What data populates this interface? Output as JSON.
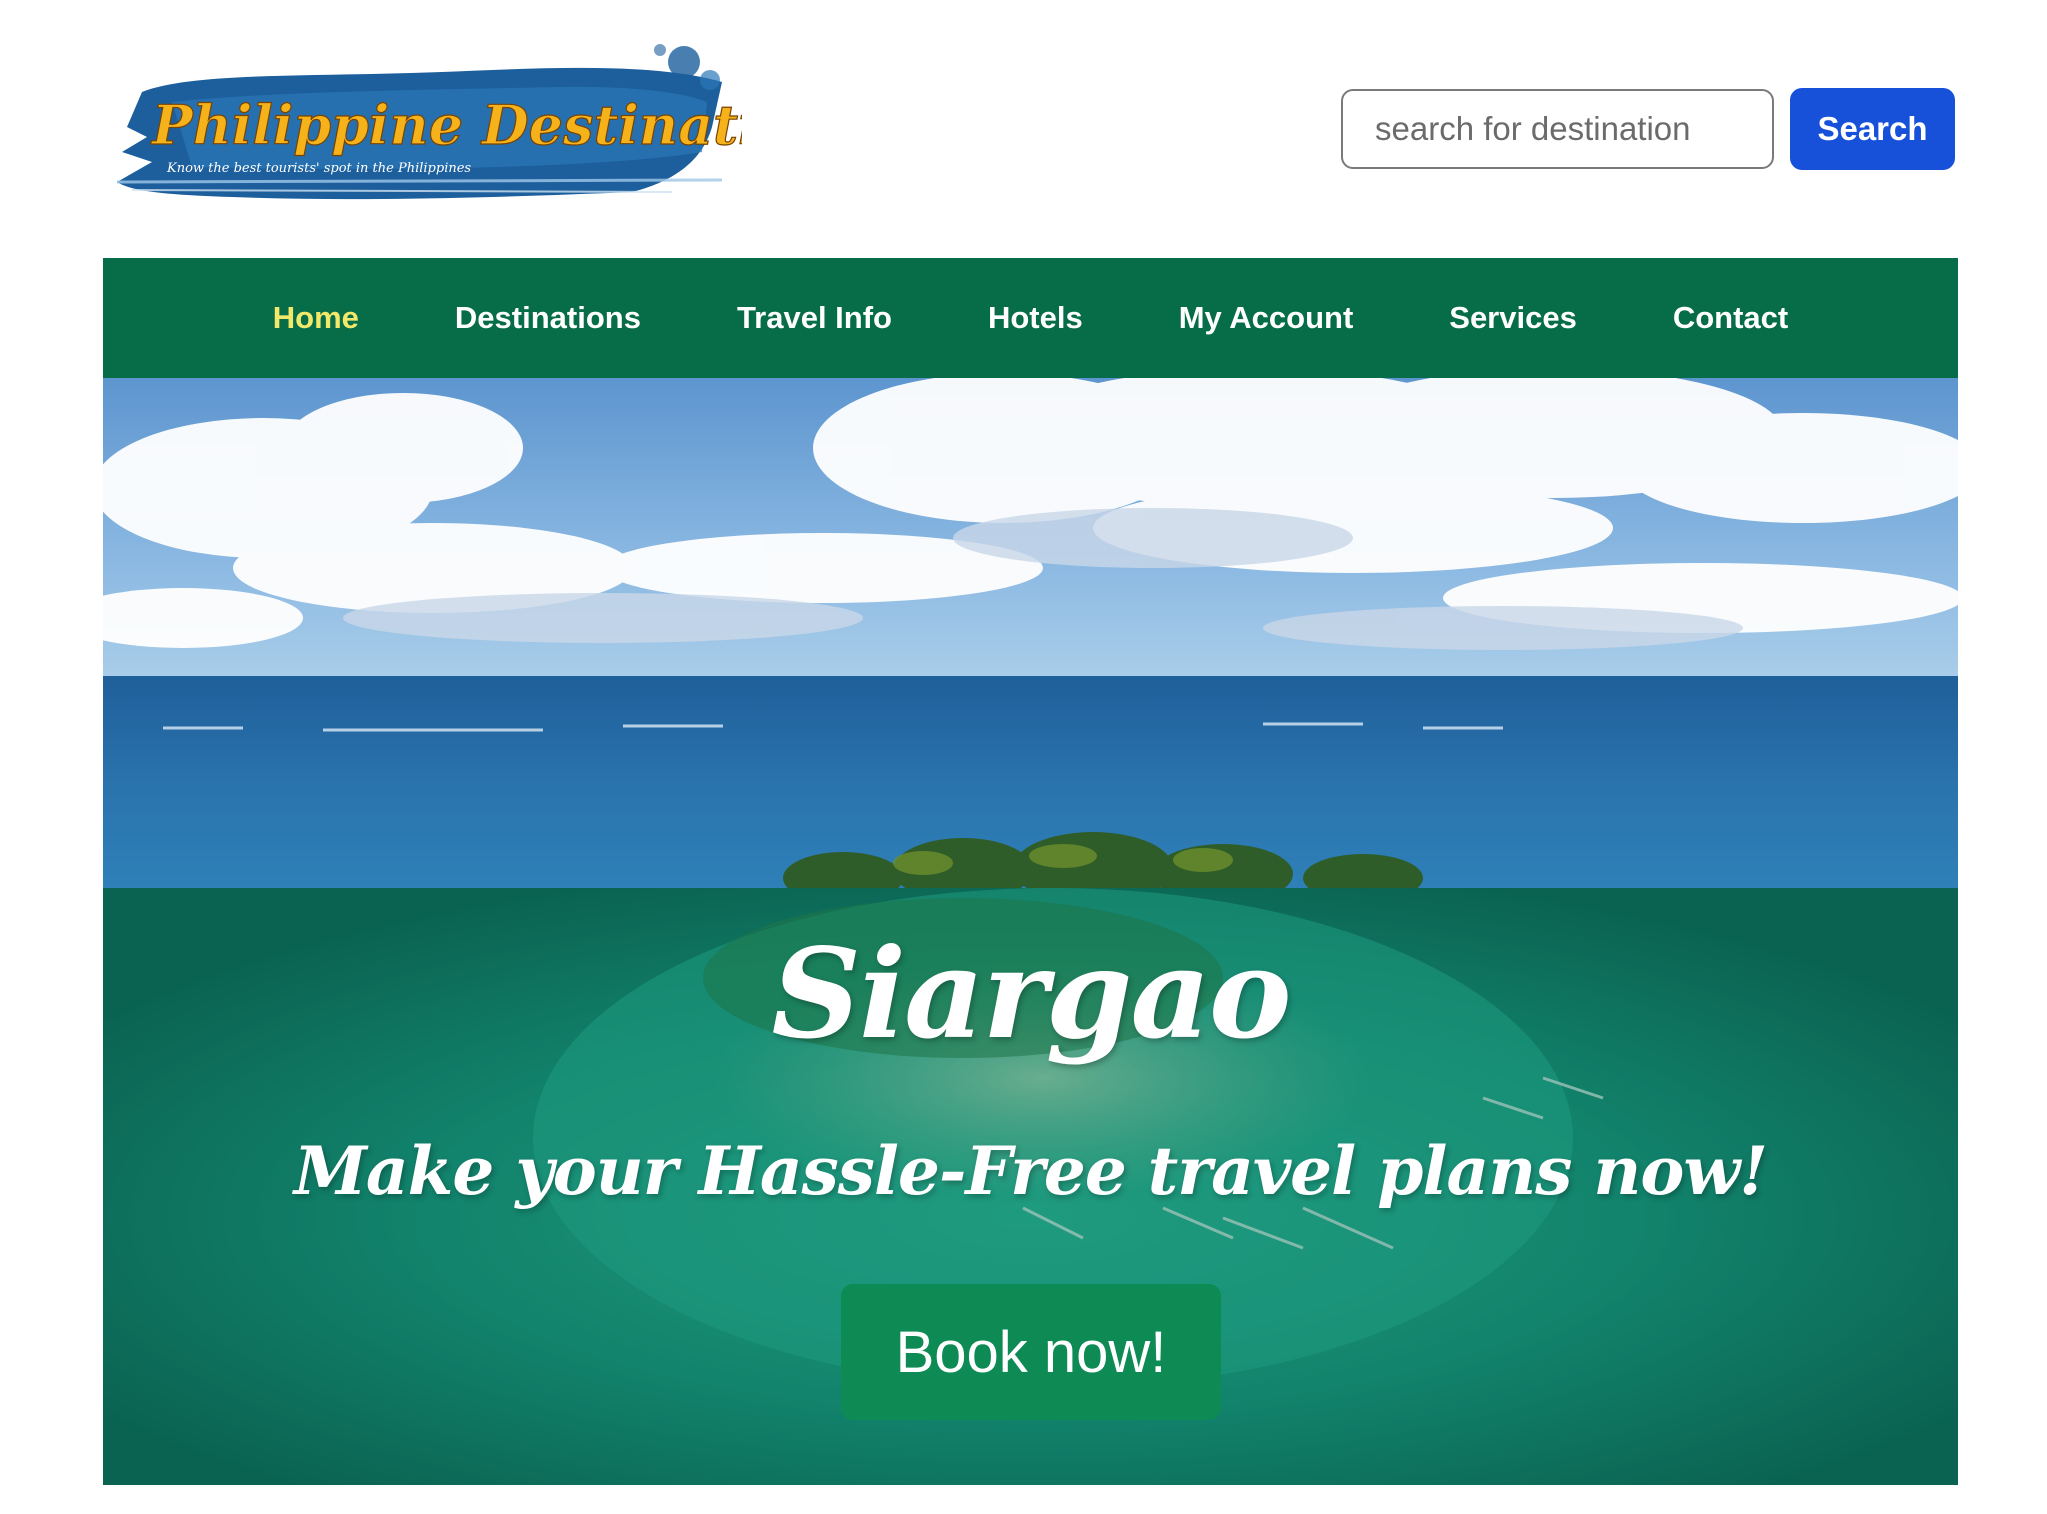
{
  "header": {
    "logo": {
      "text": "Philippine Destination",
      "tagline": "Know the best tourists' spot in the Philippines"
    },
    "search": {
      "placeholder": "search for destination",
      "button_label": "Search"
    }
  },
  "nav": {
    "active_index": 0,
    "items": [
      {
        "label": "Home"
      },
      {
        "label": "Destinations"
      },
      {
        "label": "Travel Info"
      },
      {
        "label": "Hotels"
      },
      {
        "label": "My Account"
      },
      {
        "label": "Services"
      },
      {
        "label": "Contact"
      }
    ]
  },
  "hero": {
    "title": "Siargao",
    "subtitle": "Make your Hassle-Free travel plans now!",
    "cta_label": "Book now!"
  },
  "colors": {
    "nav_background": "#076d48",
    "nav_active": "#f2e86a",
    "search_button": "#1750d9",
    "cta_button": "#0e8a55",
    "overlay": "#0a6e4c"
  }
}
